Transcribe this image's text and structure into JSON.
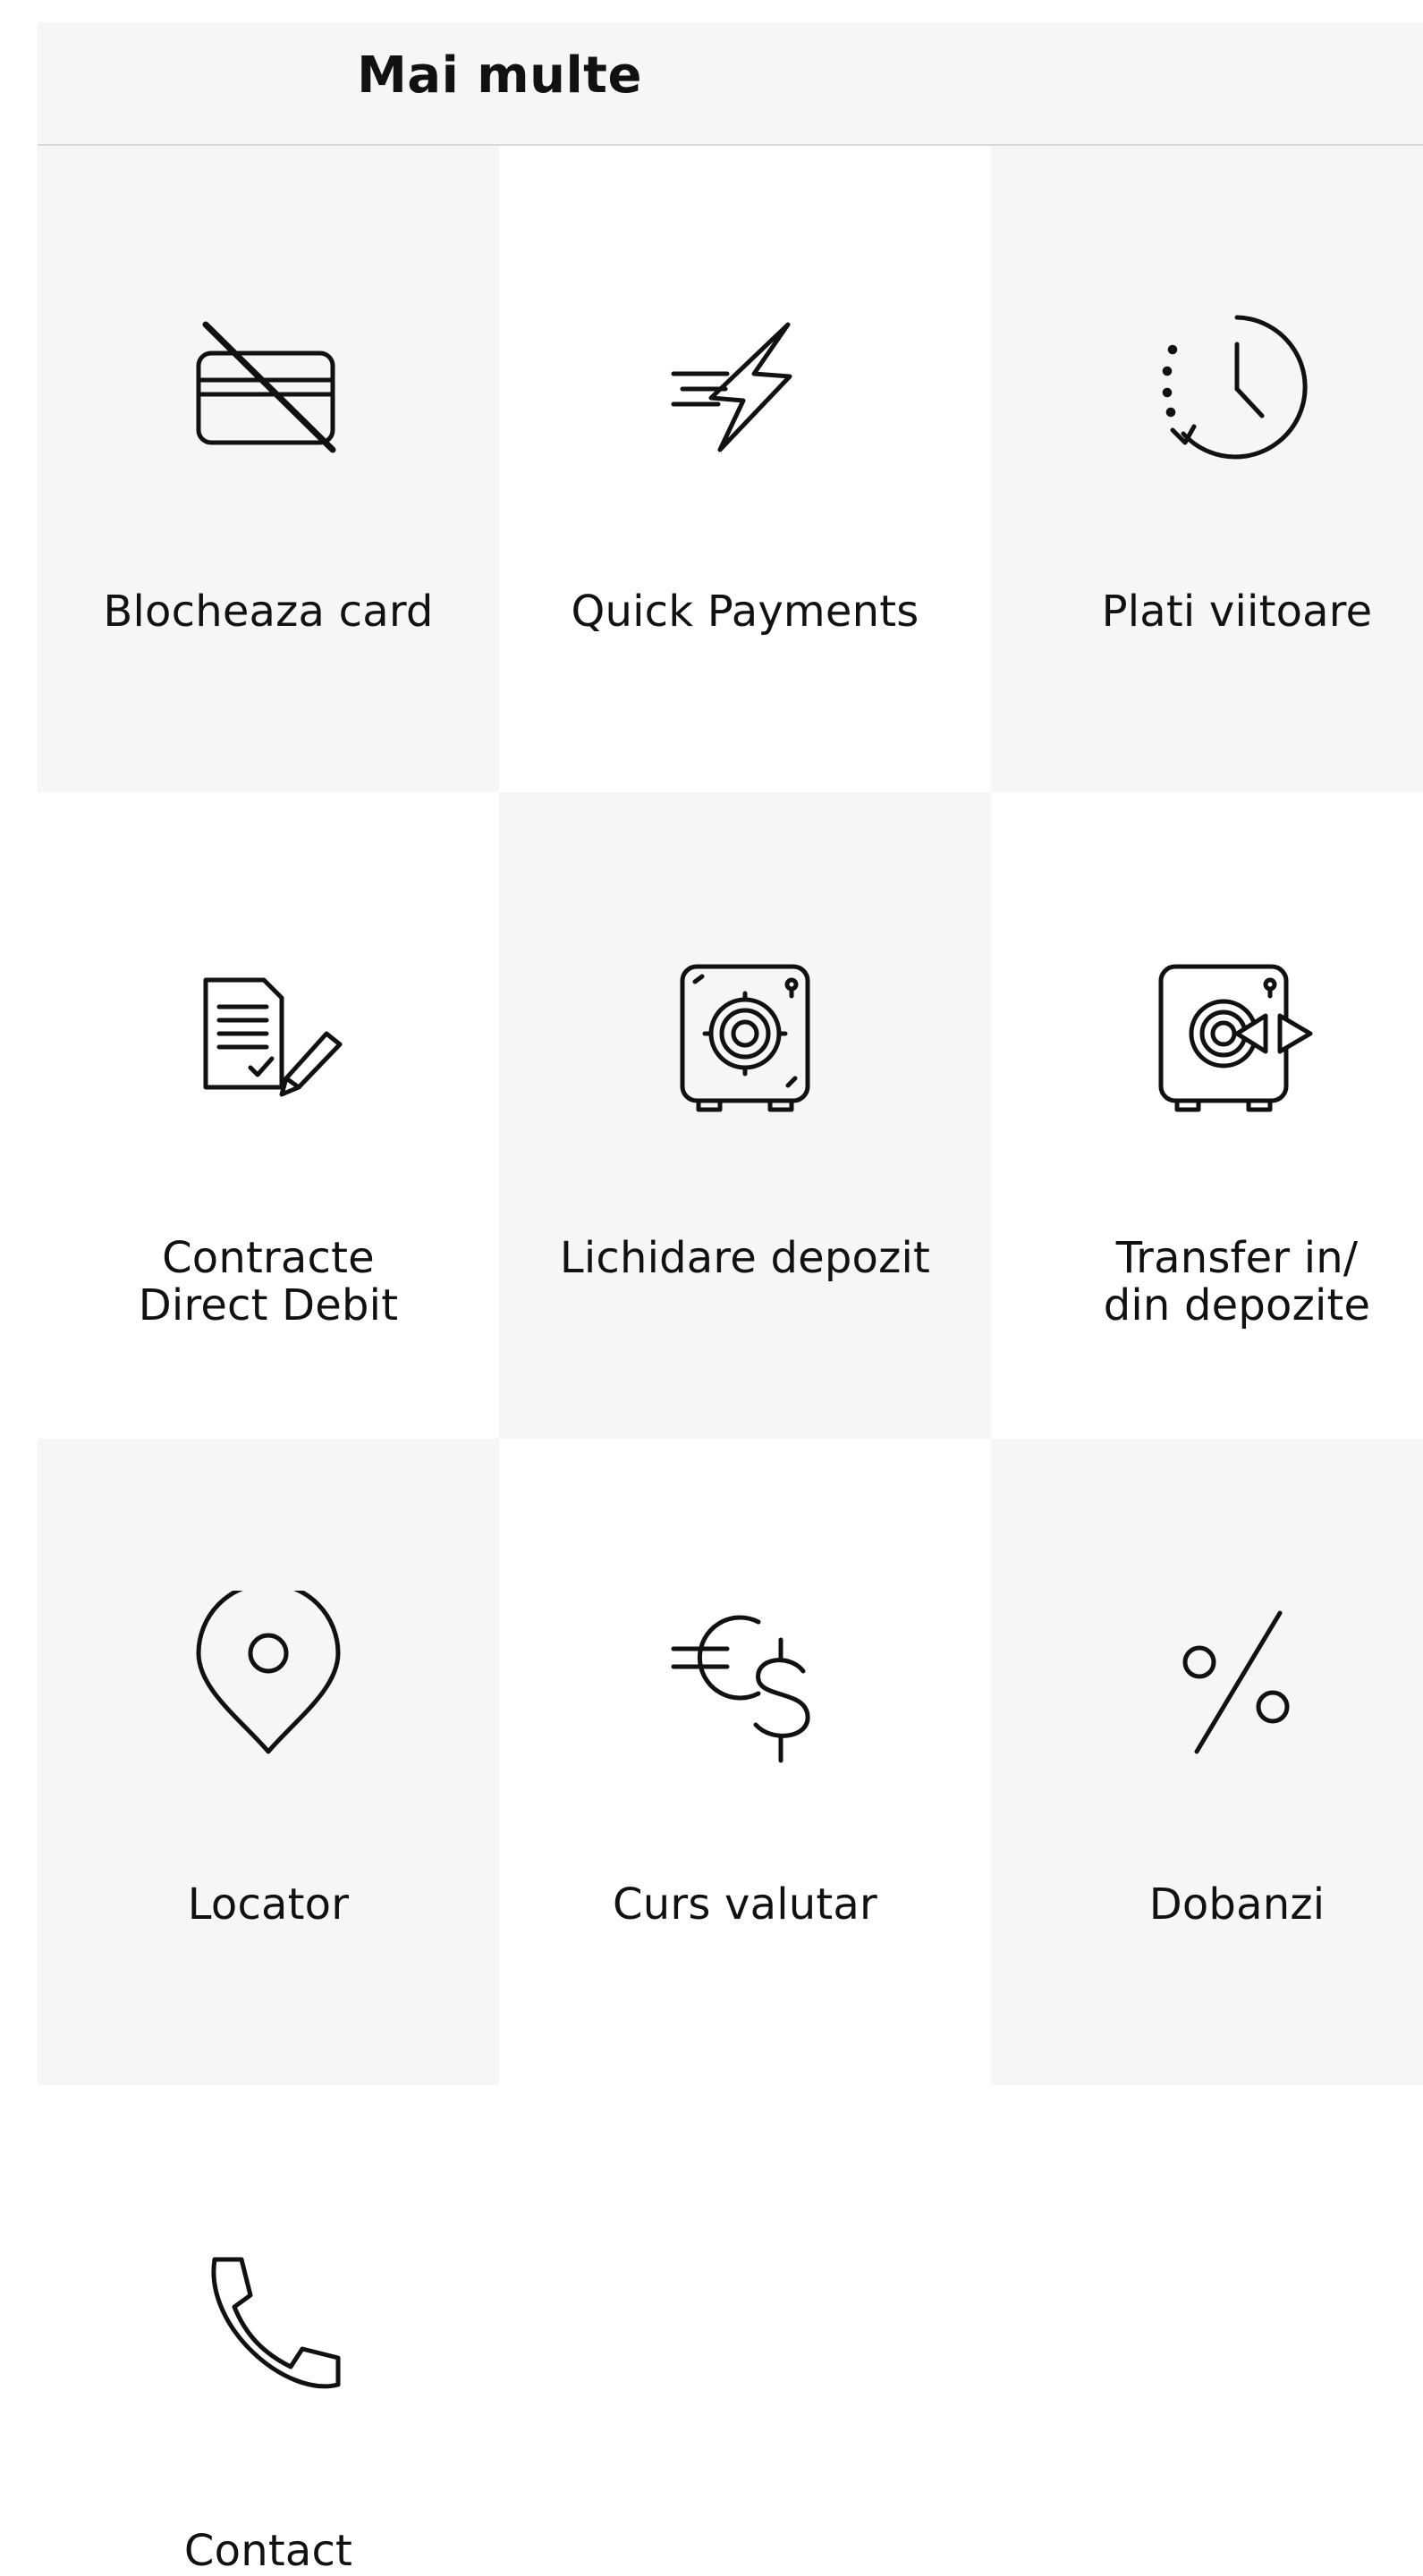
{
  "header": {
    "title": "Mai multe"
  },
  "tiles": [
    {
      "label": "Blocheaza card",
      "icon": "blocked-card-icon"
    },
    {
      "label": "Quick Payments",
      "icon": "quick-payment-lightning-icon"
    },
    {
      "label": "Plati viitoare",
      "icon": "scheduled-clock-icon"
    },
    {
      "label": "Contracte\nDirect Debit",
      "icon": "contract-sign-icon"
    },
    {
      "label": "Lichidare depozit",
      "icon": "safe-vault-icon"
    },
    {
      "label": "Transfer in/\ndin depozite",
      "icon": "vault-transfer-icon"
    },
    {
      "label": "Locator",
      "icon": "location-pin-icon"
    },
    {
      "label": "Curs valutar",
      "icon": "currency-exchange-icon"
    },
    {
      "label": "Dobanzi",
      "icon": "percent-icon"
    },
    {
      "label": "Contact",
      "icon": "phone-icon"
    }
  ],
  "colors": {
    "tile_gray": "#f6f6f6",
    "tile_white": "#ffffff",
    "text": "#111111",
    "divider": "#d8d8d8"
  }
}
